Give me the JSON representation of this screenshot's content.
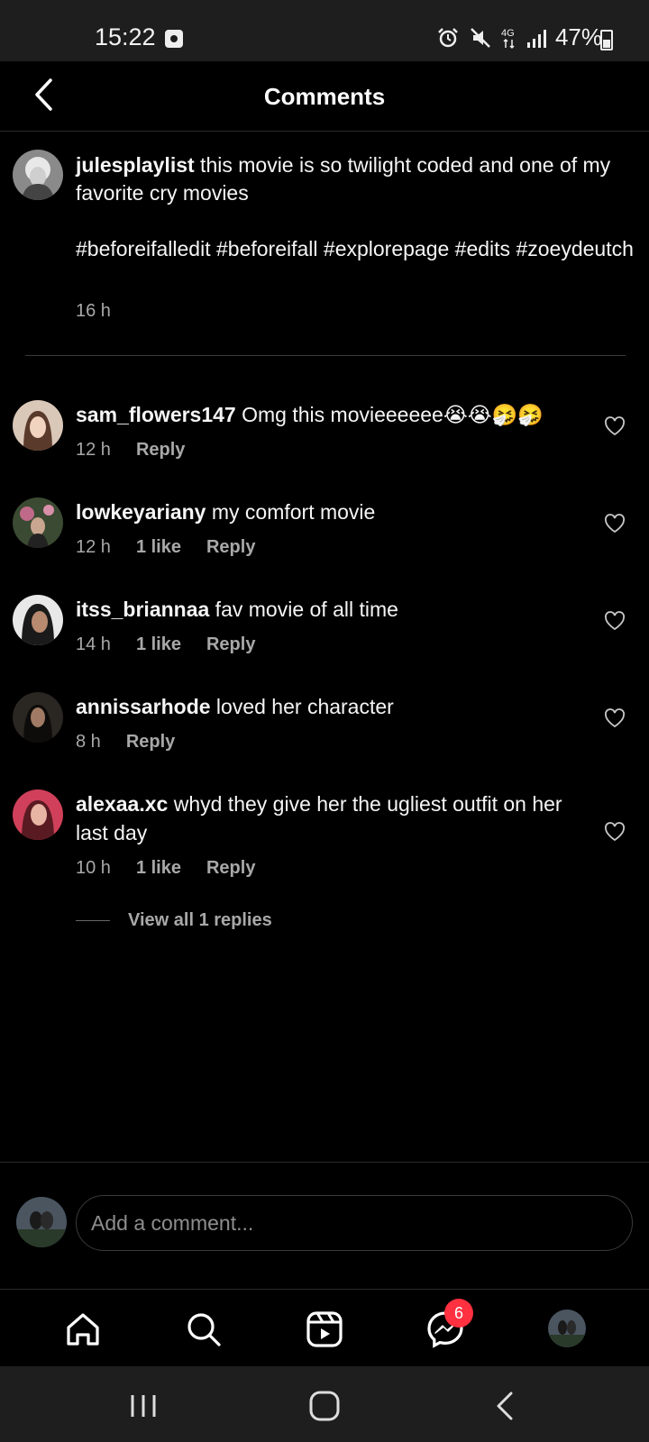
{
  "status_bar": {
    "time": "15:22",
    "network": "4G",
    "battery": "47%"
  },
  "header": {
    "title": "Comments"
  },
  "caption": {
    "username": "julesplaylist",
    "text": " this movie is so twilight coded and one of my favorite cry movies",
    "hashtags": "#beforeifalledit #beforeifall #explorepage #edits #zoeydeutch",
    "time": "16 h"
  },
  "comments": [
    {
      "username": "sam_flowers147",
      "text": " Omg this movieeeeee😭😭🤧🤧",
      "time": "12 h",
      "likes": "",
      "reply": "Reply"
    },
    {
      "username": "lowkeyariany",
      "text": " my comfort movie",
      "time": "12 h",
      "likes": "1 like",
      "reply": "Reply"
    },
    {
      "username": "itss_briannaa",
      "text": " fav movie of all time",
      "time": "14 h",
      "likes": "1 like",
      "reply": "Reply"
    },
    {
      "username": "annissarhode",
      "text": " loved her character",
      "time": "8 h",
      "likes": "",
      "reply": "Reply"
    },
    {
      "username": "alexaa.xc",
      "text": " whyd they give her the ugliest outfit on her last day",
      "time": "10 h",
      "likes": "1 like",
      "reply": "Reply"
    }
  ],
  "view_replies": "View all 1 replies",
  "composer": {
    "placeholder": "Add a comment..."
  },
  "tabbar": {
    "messages_badge": "6"
  },
  "colors": {
    "background": "#000000",
    "muted_text": "#a8a8a8",
    "badge": "#ff3040"
  }
}
